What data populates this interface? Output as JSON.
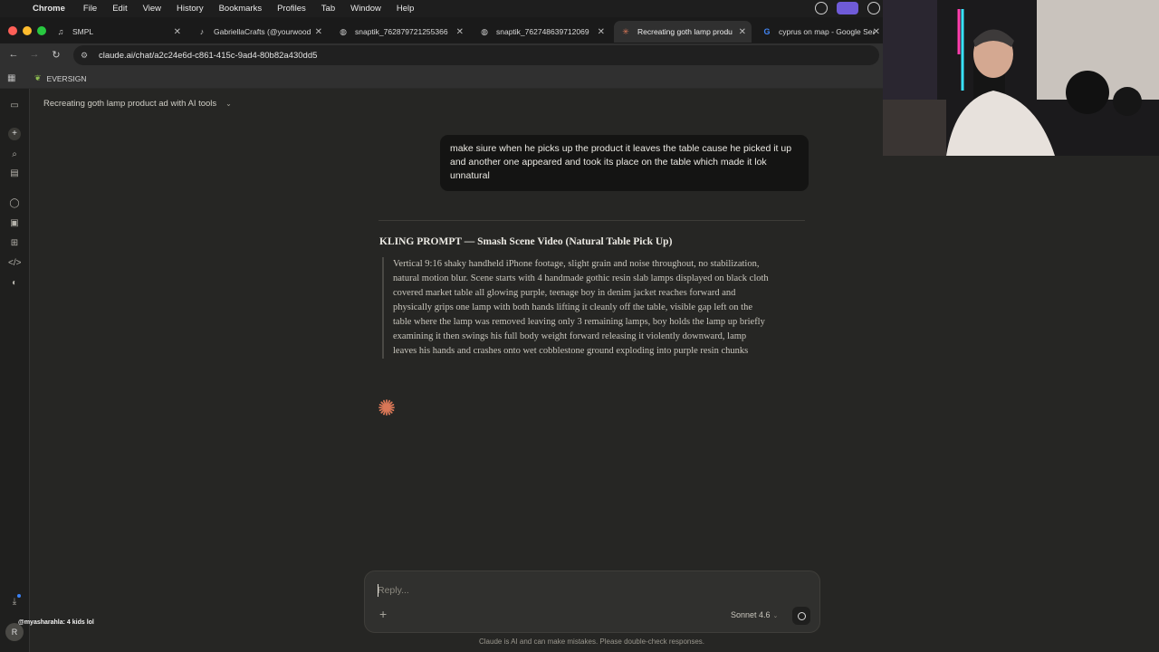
{
  "menubar": {
    "app": "Chrome",
    "items": [
      "File",
      "Edit",
      "View",
      "History",
      "Bookmarks",
      "Profiles",
      "Tab",
      "Window",
      "Help"
    ]
  },
  "tabs": [
    {
      "title": "SMPL",
      "icon": "music-note-icon"
    },
    {
      "title": "GabriellaCrafts (@yourwood",
      "icon": "tiktok-icon"
    },
    {
      "title": "snaptik_762879721255366",
      "icon": "globe-icon"
    },
    {
      "title": "snaptik_762748639712069",
      "icon": "globe-icon"
    },
    {
      "title": "Recreating goth lamp produ",
      "icon": "claude-icon",
      "active": true
    },
    {
      "title": "cyprus on map - Google Sea",
      "icon": "google-icon"
    }
  ],
  "address": {
    "url": "claude.ai/chat/a2c24e6d-c861-415c-9ad4-80b82a430dd5"
  },
  "bookmarks": {
    "items": [
      "EVERSIGN"
    ]
  },
  "chat": {
    "title": "Recreating goth lamp product ad with AI tools",
    "user_message": "make siure when he picks up the product it leaves the table cause he picked it up and another one appeared and took its place on the table which made it lok unnatural",
    "response_heading": "KLING PROMPT — Smash Scene Video (Natural Table Pick Up)",
    "response_quote": "Vertical 9:16 shaky handheld iPhone footage, slight grain and noise throughout, no stabilization, natural motion blur. Scene starts with 4 handmade gothic resin slab lamps displayed on black cloth covered market table all glowing purple, teenage boy in denim jacket reaches forward and physically grips one lamp with both hands lifting it cleanly off the table, visible gap left on the table where the lamp was removed leaving only 3 remaining lamps, boy holds the lamp up briefly examining it then swings his full body weight forward releasing it violently downward, lamp leaves his hands and crashes onto wet cobblestone ground exploding into purple resin chunks"
  },
  "composer": {
    "placeholder": "Reply...",
    "model": "Sonnet 4.6"
  },
  "disclaimer": "Claude is AI and can make mistakes. Please double-check responses.",
  "overlay": {
    "chat_line": "@myasharahla: 4 kids lol"
  },
  "user": {
    "initial": "R"
  },
  "colors": {
    "accent": "#d97757",
    "background": "#262624",
    "user_bubble": "#141413"
  }
}
